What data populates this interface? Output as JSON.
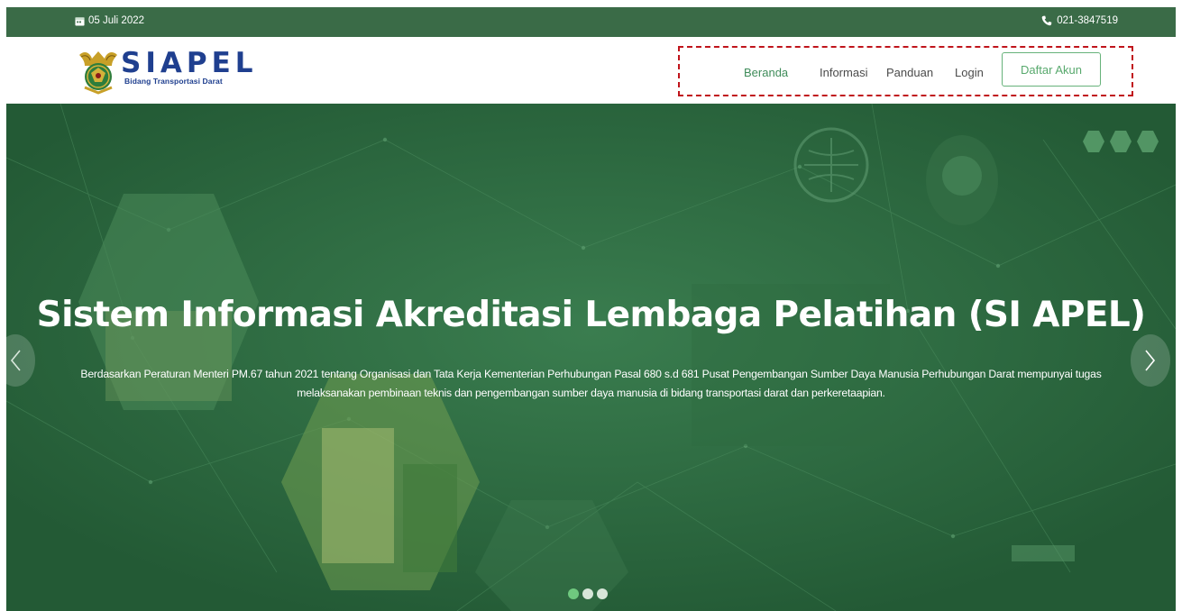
{
  "topbar": {
    "date": "05 Juli 2022",
    "phone": "021-3847519"
  },
  "brand": {
    "name": "SIAPEL",
    "subtitle": "Bidang Transportasi Darat"
  },
  "nav": {
    "items": [
      "Beranda",
      "Informasi",
      "Panduan",
      "Login"
    ],
    "active": "Beranda",
    "register_label": "Daftar Akun"
  },
  "hero": {
    "title": "Sistem Informasi Akreditasi Lembaga Pelatihan (SI APEL)",
    "description": "Berdasarkan Peraturan Menteri PM.67 tahun 2021 tentang Organisasi dan Tata Kerja Kementerian Perhubungan Pasal 680 s.d 681 Pusat Pengembangan Sumber Daya Manusia Perhubungan Darat mempunyai tugas melaksanakan pembinaan teknis dan pengembangan sumber daya manusia di bidang transportasi darat dan perkeretaapian.",
    "slides": 3,
    "active_slide": 1
  },
  "colors": {
    "topbar": "#3a6b47",
    "hero": "#2b6b40",
    "accent": "#3f8c5a",
    "brand": "#1f3f8f",
    "highlight_border": "#c0141b"
  },
  "icons": {
    "date": "calendar-icon",
    "phone": "phone-icon",
    "prev": "chevron-left-icon",
    "next": "chevron-right-icon"
  }
}
